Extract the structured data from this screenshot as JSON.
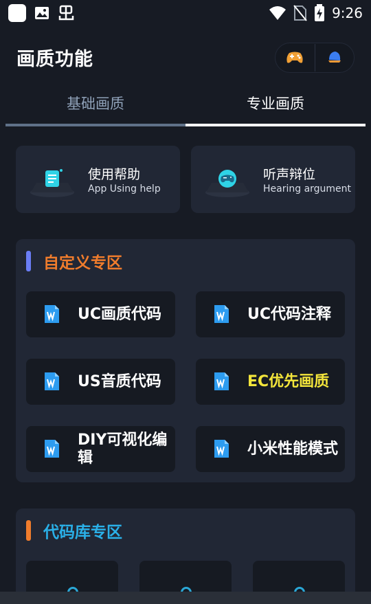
{
  "status_bar": {
    "time": "9:26",
    "left_icons": [
      "app-square-icon",
      "image-icon",
      "bug-icon"
    ],
    "right_icons": [
      "wifi-icon",
      "no-sim-icon",
      "battery-charging-icon"
    ]
  },
  "header": {
    "title": "画质功能",
    "capsule_icons": [
      "gamepad-icon",
      "bell-icon"
    ]
  },
  "tabs": [
    {
      "label": "基础画质",
      "active": false
    },
    {
      "label": "专业画质",
      "active": true
    }
  ],
  "help_cards": [
    {
      "title": "使用帮助",
      "subtitle": "App Using help",
      "icon": "document-icon"
    },
    {
      "title": "听声辩位",
      "subtitle": "Hearing argument",
      "icon": "gamepad-icon"
    }
  ],
  "custom_section": {
    "title": "自定义专区",
    "title_color": "#f07c2c",
    "bar_color": "#6a7df5",
    "items": [
      {
        "label": "UC画质代码",
        "color": "#ffffff"
      },
      {
        "label": "UC代码注释",
        "color": "#ffffff"
      },
      {
        "label": "US音质代码",
        "color": "#ffffff"
      },
      {
        "label": "EC优先画质",
        "color": "#f3e53b"
      },
      {
        "label": "DIY可视化编辑",
        "color": "#ffffff"
      },
      {
        "label": "小米性能模式",
        "color": "#ffffff"
      }
    ]
  },
  "library_section": {
    "title": "代码库专区",
    "title_color": "#2ab0e8",
    "bar_color": "#f07c2c"
  }
}
